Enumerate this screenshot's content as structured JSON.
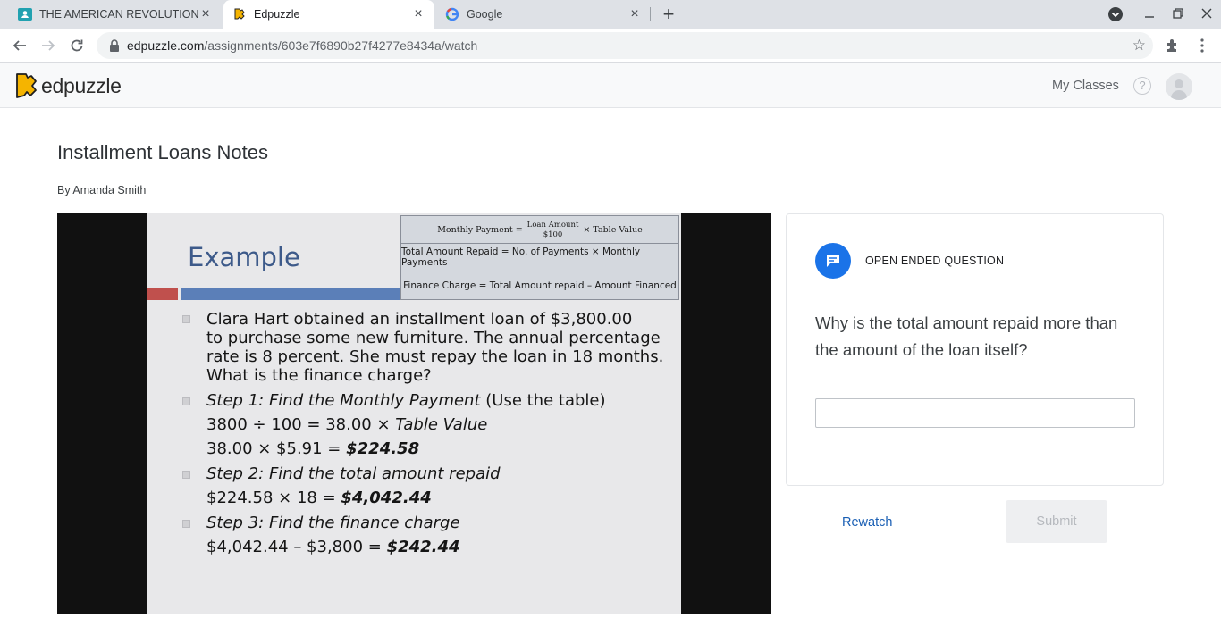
{
  "browser": {
    "tabs": [
      {
        "title": "THE AMERICAN REVOLUTION",
        "active": false,
        "icon": "classroom-icon"
      },
      {
        "title": "Edpuzzle",
        "active": true,
        "icon": "edpuzzle-icon"
      },
      {
        "title": "Google",
        "active": false,
        "icon": "google-icon"
      }
    ],
    "url_host": "edpuzzle.com",
    "url_path": "/assignments/603e7f6890b27f4277e8434a/watch"
  },
  "header": {
    "logo_text": "edpuzzle",
    "my_classes_label": "My Classes",
    "help_symbol": "?"
  },
  "assignment": {
    "title": "Installment Loans Notes",
    "author": "By Amanda Smith"
  },
  "slide": {
    "title": "Example",
    "formula_monthly_prefix": "Monthly Payment =",
    "formula_monthly_num": "Loan Amount",
    "formula_monthly_den": "$100",
    "formula_monthly_suffix": "× Table Value",
    "formula_total": "Total Amount Repaid = No. of Payments × Monthly Payments",
    "formula_finance": "Finance Charge = Total Amount repaid – Amount Financed",
    "problem_lines": [
      "Clara Hart obtained an installment loan of $3,800.00",
      "to purchase some new furniture.  The annual percentage",
      "rate is 8 percent.  She must repay the loan in 18 months.",
      "What is the finance charge?"
    ],
    "step1_label": "Step 1: Find the Monthly Payment",
    "step1_note": " (Use the table)",
    "step1_line1_a": "3800 ÷ 100 = 38.00 × ",
    "step1_line1_b": "Table Value",
    "step1_line2_a": "38.00 × $5.91 = ",
    "step1_line2_b": "$224.58",
    "step2_label": "Step 2: Find the total amount repaid",
    "step2_line_a": "$224.58 × 18 = ",
    "step2_line_b": "$4,042.44",
    "step3_label": "Step 3: Find the finance charge",
    "step3_line_a": "$4,042.44 – $3,800 = ",
    "step3_line_b": "$242.44"
  },
  "question": {
    "type_label": "OPEN ENDED QUESTION",
    "text": "Why is the total amount repaid more than the amount of the loan itself?",
    "answer_value": "",
    "answer_placeholder": ""
  },
  "actions": {
    "rewatch_label": "Rewatch",
    "submit_label": "Submit"
  },
  "colors": {
    "accent": "#1a73e8",
    "link": "#1a5fb4",
    "logo": "#f5b400"
  }
}
